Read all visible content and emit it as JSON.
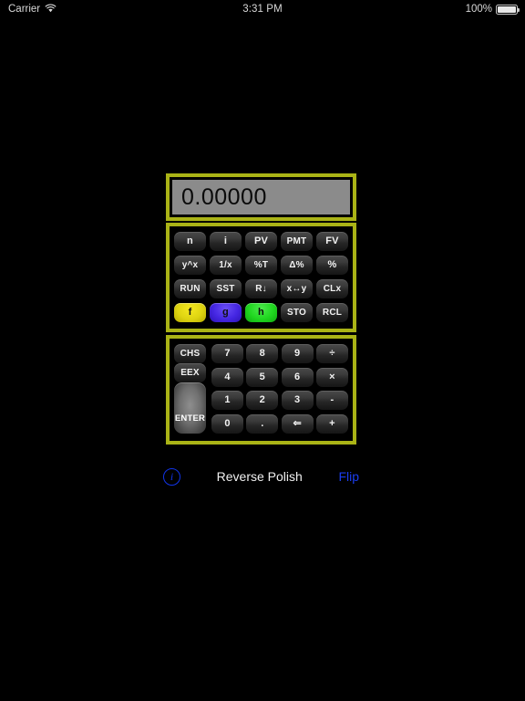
{
  "statusbar": {
    "carrier": "Carrier",
    "wifi_icon": "wifi-icon",
    "time": "3:31 PM",
    "battery_percent": "100%",
    "battery_icon": "battery-icon"
  },
  "calculator": {
    "display": {
      "value": "0.00000",
      "background": "#8b8b8b",
      "text_color": "#0a0a0a"
    },
    "frame_color": "#aab316",
    "function_rows": [
      [
        {
          "label": "n",
          "style": "dark"
        },
        {
          "label": "i",
          "style": "dark"
        },
        {
          "label": "PV",
          "style": "dark"
        },
        {
          "label": "PMT",
          "style": "dark"
        },
        {
          "label": "FV",
          "style": "dark"
        }
      ],
      [
        {
          "label": "y^x",
          "style": "dark"
        },
        {
          "label": "1/x",
          "style": "dark"
        },
        {
          "label": "%T",
          "style": "dark"
        },
        {
          "label": "Δ%",
          "style": "dark"
        },
        {
          "label": "%",
          "style": "dark"
        }
      ],
      [
        {
          "label": "RUN",
          "style": "dark"
        },
        {
          "label": "SST",
          "style": "dark"
        },
        {
          "label": "R↓",
          "style": "dark"
        },
        {
          "label": "x↔y",
          "style": "dark"
        },
        {
          "label": "CLx",
          "style": "dark"
        }
      ],
      [
        {
          "label": "f",
          "style": "f"
        },
        {
          "label": "g",
          "style": "g"
        },
        {
          "label": "h",
          "style": "h"
        },
        {
          "label": "STO",
          "style": "dark"
        },
        {
          "label": "RCL",
          "style": "dark"
        }
      ]
    ],
    "enter_label": "ENTER",
    "numeric_left": [
      {
        "label": "CHS"
      },
      {
        "label": "EEX"
      }
    ],
    "numeric_rows": [
      [
        {
          "label": "7"
        },
        {
          "label": "8"
        },
        {
          "label": "9"
        },
        {
          "label": "÷"
        }
      ],
      [
        {
          "label": "4"
        },
        {
          "label": "5"
        },
        {
          "label": "6"
        },
        {
          "label": "×"
        }
      ],
      [
        {
          "label": "1"
        },
        {
          "label": "2"
        },
        {
          "label": "3"
        },
        {
          "label": "-"
        }
      ],
      [
        {
          "label": "0"
        },
        {
          "label": "."
        },
        {
          "label": "⇐"
        },
        {
          "label": "+"
        }
      ]
    ],
    "key_colors": {
      "f": "#ded411",
      "g": "#4426e2",
      "h": "#1fd61f"
    }
  },
  "footer": {
    "info_icon": "info-icon",
    "info_glyph": "i",
    "mode_label": "Reverse Polish",
    "flip_label": "Flip",
    "flip_color": "#1a3df0"
  }
}
